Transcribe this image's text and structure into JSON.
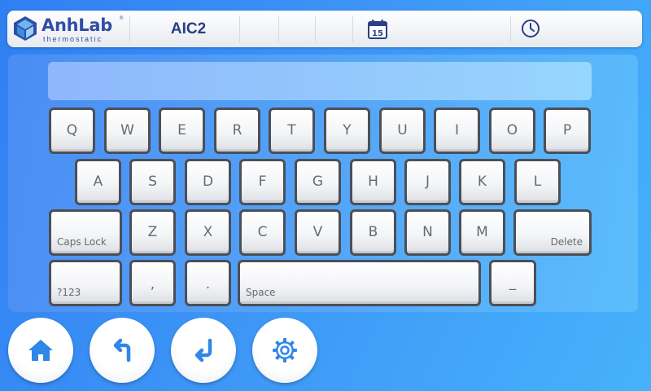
{
  "header": {
    "brand": "AnhLab",
    "brand_mark": "®",
    "brand_sub": "thermostatic",
    "device_name": "AIC2",
    "calendar_day": "15",
    "calendar_icon": "calendar-icon",
    "clock_icon": "clock-icon"
  },
  "keyboard": {
    "input_value": "",
    "rows": [
      [
        "Q",
        "W",
        "E",
        "R",
        "T",
        "Y",
        "U",
        "I",
        "O",
        "P"
      ],
      [
        "A",
        "S",
        "D",
        "F",
        "G",
        "H",
        "J",
        "K",
        "L"
      ],
      [
        "Caps Lock",
        "Z",
        "X",
        "C",
        "V",
        "B",
        "N",
        "M",
        "Delete"
      ],
      [
        "?123",
        ",",
        ".",
        "Space",
        "_"
      ]
    ]
  },
  "nav": {
    "home_icon": "home-icon",
    "back_icon": "back-arrow-icon",
    "enter_icon": "enter-icon",
    "settings_icon": "gear-icon"
  },
  "colors": {
    "brand_blue": "#2f4ea6",
    "icon_blue": "#2f87e8",
    "key_border": "#4b4f57",
    "key_text": "#666b72"
  }
}
